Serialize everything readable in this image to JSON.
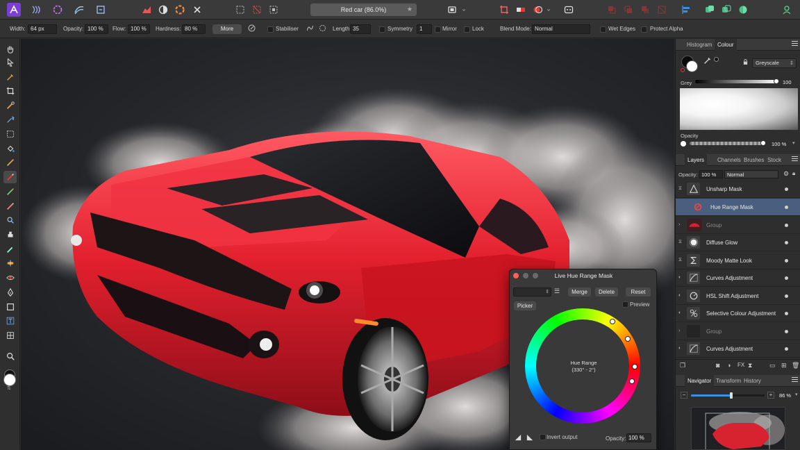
{
  "document_title": "Red car (86.0%)",
  "context_toolbar": {
    "width_label": "Width:",
    "width_value": "64 px",
    "opacity_label": "Opacity:",
    "opacity_value": "100 %",
    "flow_label": "Flow:",
    "flow_value": "100 %",
    "hardness_label": "Hardness:",
    "hardness_value": "80 %",
    "more_label": "More",
    "stabiliser_label": "Stabiliser",
    "length_label": "Length",
    "length_value": "35",
    "symmetry_label": "Symmetry",
    "symmetry_value": "1",
    "mirror_label": "Mirror",
    "lock_label": "Lock",
    "blend_mode_label": "Blend Mode:",
    "blend_mode_value": "Normal",
    "wet_edges_label": "Wet Edges",
    "protect_alpha_label": "Protect Alpha"
  },
  "colour_panel": {
    "tabs": [
      "Histogram",
      "Colour"
    ],
    "active_tab": "Colour",
    "mode": "Greyscale",
    "grey_label": "Grey",
    "grey_value": "100",
    "opacity_label": "Opacity",
    "opacity_value": "100 %"
  },
  "layers_panel": {
    "tabs": [
      "Layers",
      "Channels",
      "Brushes",
      "Stock"
    ],
    "active_tab": "Layers",
    "opacity_label": "Opacity:",
    "opacity_value": "100 %",
    "blend_mode": "Normal",
    "layers": [
      {
        "name": "Unsharp Mask",
        "icon": "triangle-icon"
      },
      {
        "name": "Hue Range Mask",
        "icon": "hue-range-icon"
      },
      {
        "name": "Group",
        "icon": "car-thumbnail"
      },
      {
        "name": "Diffuse Glow",
        "icon": "glow-icon"
      },
      {
        "name": "Moody Matte Look",
        "icon": "sigma-icon"
      },
      {
        "name": "Curves Adjustment",
        "icon": "curves-icon"
      },
      {
        "name": "HSL Shift Adjustment",
        "icon": "hsl-icon"
      },
      {
        "name": "Selective Colour Adjustment",
        "icon": "selective-colour-icon"
      },
      {
        "name": "Group",
        "icon": "empty-thumbnail"
      },
      {
        "name": "Curves Adjustment",
        "icon": "curves-icon"
      }
    ]
  },
  "navigator_panel": {
    "tabs": [
      "Navigator",
      "Transform",
      "History"
    ],
    "active_tab": "Navigator",
    "zoom_value": "86 %",
    "zoom_level": 0.86
  },
  "hue_dialog": {
    "title": "Live Hue Range Mask",
    "merge_label": "Merge",
    "delete_label": "Delete",
    "reset_label": "Reset",
    "picker_label": "Picker",
    "preview_label": "Preview",
    "wheel_label": "Hue Range",
    "wheel_range": "(330° - 2°)",
    "invert_label": "Invert output",
    "opacity_label": "Opacity:",
    "opacity_value": "100 %"
  }
}
